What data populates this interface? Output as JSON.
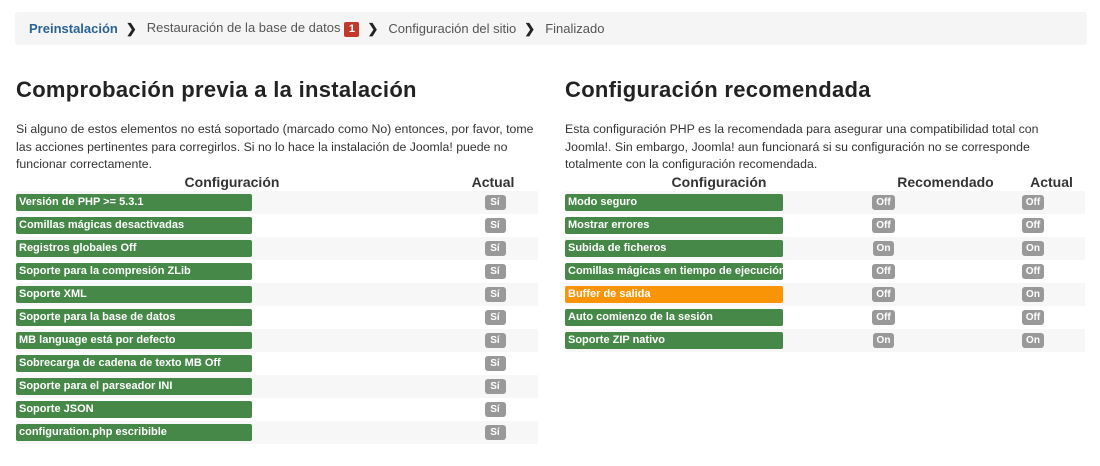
{
  "breadcrumb": {
    "steps": [
      "Preinstalación",
      "Restauración de la base de datos",
      "Configuración del sitio",
      "Finalizado"
    ],
    "badge": "1"
  },
  "left": {
    "title": "Comprobación previa a la instalación",
    "description": "Si alguno de estos elementos no está soportado (marcado como No) entonces, por favor, tome las acciones pertinentes para corregirlos. Si no lo hace la instalación de Joomla! puede no funcionar correctamente.",
    "headers": {
      "config": "Configuración",
      "actual": "Actual"
    },
    "rows": [
      {
        "label": "Versión de PHP >= 5.3.1",
        "actual": "Sí"
      },
      {
        "label": "Comillas mágicas desactivadas",
        "actual": "Sí"
      },
      {
        "label": "Registros globales Off",
        "actual": "Sí"
      },
      {
        "label": "Soporte para la compresión ZLib",
        "actual": "Sí"
      },
      {
        "label": "Soporte XML",
        "actual": "Sí"
      },
      {
        "label": "Soporte para la base de datos",
        "actual": "Sí"
      },
      {
        "label": "MB language está por defecto",
        "actual": "Sí"
      },
      {
        "label": "Sobrecarga de cadena de texto MB Off",
        "actual": "Sí"
      },
      {
        "label": "Soporte para el parseador INI",
        "actual": "Sí"
      },
      {
        "label": "Soporte JSON",
        "actual": "Sí"
      },
      {
        "label": "configuration.php escribible",
        "actual": "Sí"
      }
    ]
  },
  "right": {
    "title": "Configuración recomendada",
    "description": "Esta configuración PHP es la recomendada para asegurar una compatibilidad total con Joomla!. Sin embargo, Joomla! aun funcionará si su configuración no se corresponde totalmente con la configuración recomendada.",
    "headers": {
      "config": "Configuración",
      "recommended": "Recomendado",
      "actual": "Actual"
    },
    "rows": [
      {
        "label": "Modo seguro",
        "recommended": "Off",
        "actual": "Off"
      },
      {
        "label": "Mostrar errores",
        "recommended": "Off",
        "actual": "Off"
      },
      {
        "label": "Subida de ficheros",
        "recommended": "On",
        "actual": "On"
      },
      {
        "label": "Comillas mágicas en tiempo de ejecución",
        "recommended": "Off",
        "actual": "Off"
      },
      {
        "label": "Buffer de salida",
        "recommended": "Off",
        "actual": "On"
      },
      {
        "label": "Auto comienzo de la sesión",
        "recommended": "Off",
        "actual": "Off"
      },
      {
        "label": "Soporte ZIP nativo",
        "recommended": "On",
        "actual": "On"
      }
    ]
  },
  "colors": {
    "ok": "#468847",
    "warning": "#f89406",
    "pill": "#999999",
    "badge": "#c0392b",
    "active_step": "#2a6496"
  }
}
